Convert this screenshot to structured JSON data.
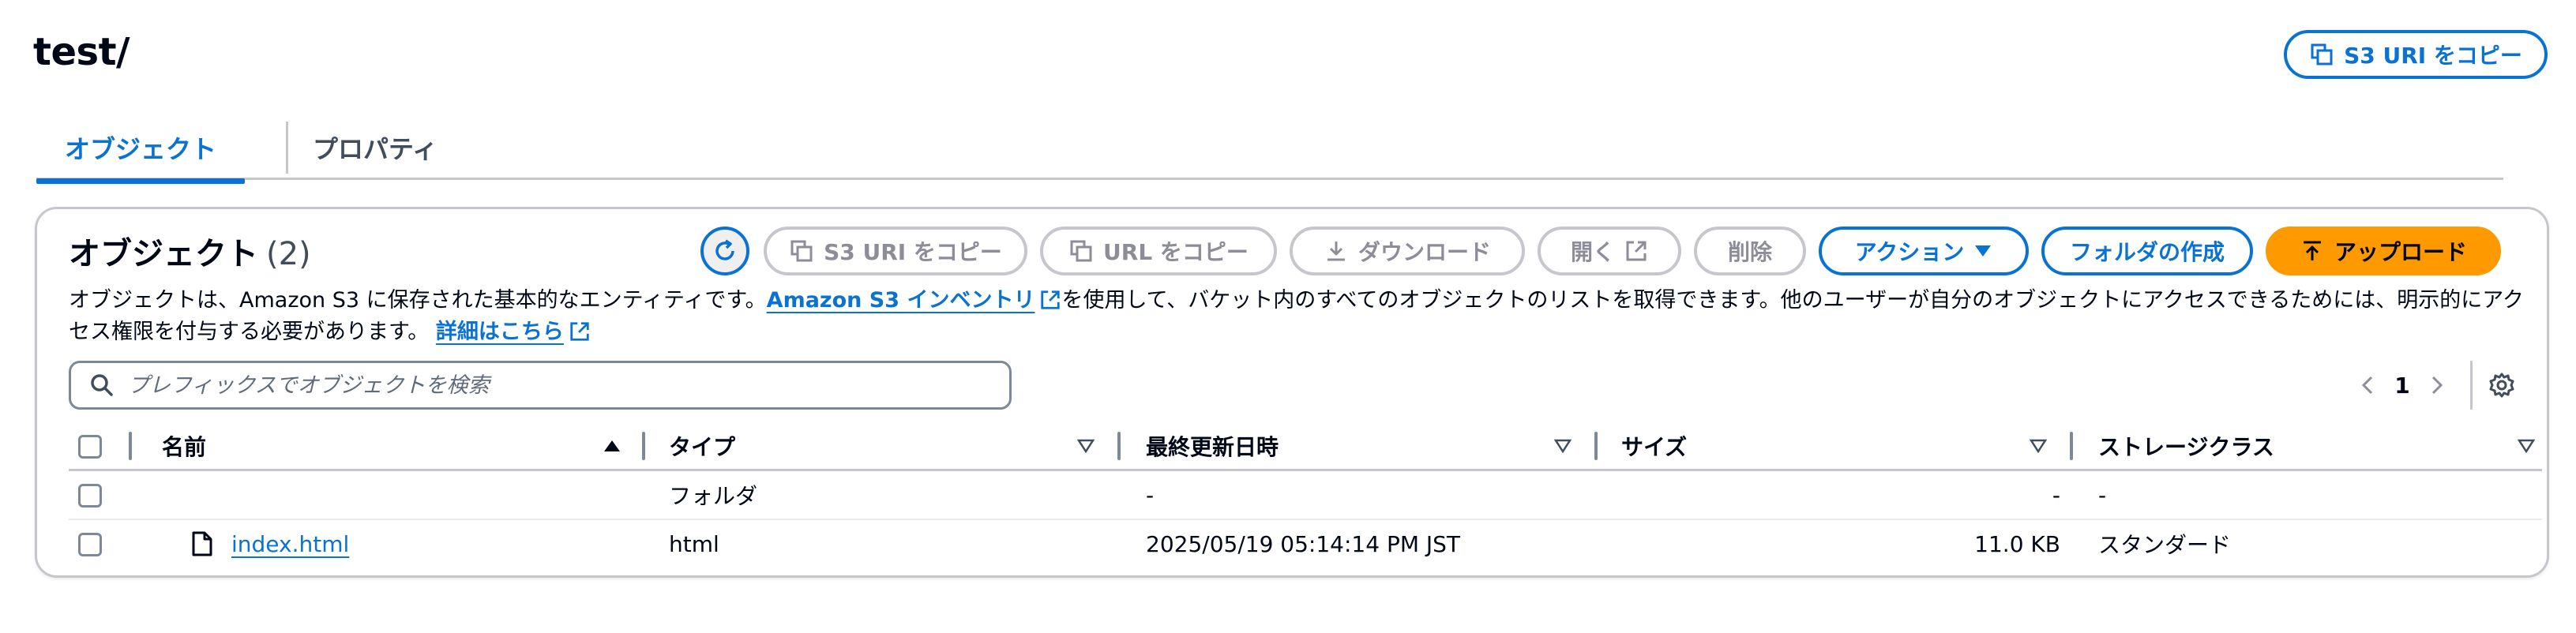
{
  "header": {
    "title": "test/",
    "copy_s3_uri": "S3 URI をコピー"
  },
  "tabs": [
    {
      "label": "オブジェクト",
      "active": true
    },
    {
      "label": "プロパティ",
      "active": false
    }
  ],
  "panel": {
    "title": "オブジェクト",
    "count": "(2)",
    "toolbar": {
      "copy_s3_uri": "S3 URI をコピー",
      "copy_url": "URL をコピー",
      "download": "ダウンロード",
      "open": "開く",
      "delete": "削除",
      "actions": "アクション",
      "create_folder": "フォルダの作成",
      "upload": "アップロード"
    },
    "description": {
      "part1": "オブジェクトは、Amazon S3 に保存された基本的なエンティティです。",
      "inventory_link": "Amazon S3 インベントリ",
      "part2": "を使用して、バケット内のすべてのオブジェクトのリストを取得できます。他のユーザーが自分のオブジェクトにアクセスできるためには、明示的にアクセス権限を付与する必要があります。",
      "learn_more_link": "詳細はこちら"
    },
    "search": {
      "placeholder": "プレフィックスでオブジェクトを検索"
    },
    "pagination": {
      "current_page": "1"
    }
  },
  "table": {
    "columns": {
      "name": "名前",
      "type": "タイプ",
      "modified": "最終更新日時",
      "size": "サイズ",
      "storage_class": "ストレージクラス"
    },
    "rows": [
      {
        "name": "",
        "type": "フォルダ",
        "modified": "-",
        "size": "-",
        "storage_class": "-"
      },
      {
        "name": "index.html",
        "type": "html",
        "modified": "2025/05/19 05:14:14 PM JST",
        "size": "11.0 KB",
        "storage_class": "スタンダード"
      }
    ]
  },
  "colors": {
    "accent": "#0972d3",
    "primary_button": "#ff9900",
    "disabled": "#8d8d99",
    "border": "#c6c6cd"
  },
  "icons": [
    "copy-icon",
    "refresh-icon",
    "download-icon",
    "external-link-icon",
    "caret-down-icon",
    "upload-icon",
    "search-icon",
    "chevron-left-icon",
    "chevron-right-icon",
    "gear-icon",
    "sort-up-icon",
    "sort-down-icon",
    "file-icon"
  ]
}
